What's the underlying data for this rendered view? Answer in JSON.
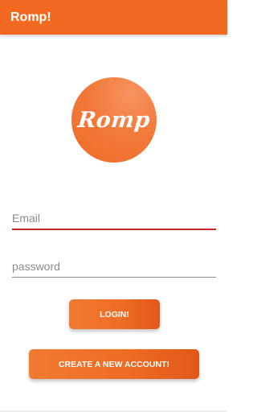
{
  "app_bar": {
    "title": "Romp!"
  },
  "logo": {
    "text": "Romp"
  },
  "form": {
    "email_placeholder": "Email",
    "password_placeholder": "password"
  },
  "buttons": {
    "login_label": "LOGIN!",
    "create_account_label": "CREATE A NEW ACCOUNT!"
  },
  "colors": {
    "primary": "#f26a21",
    "accent_error": "#c62828"
  }
}
